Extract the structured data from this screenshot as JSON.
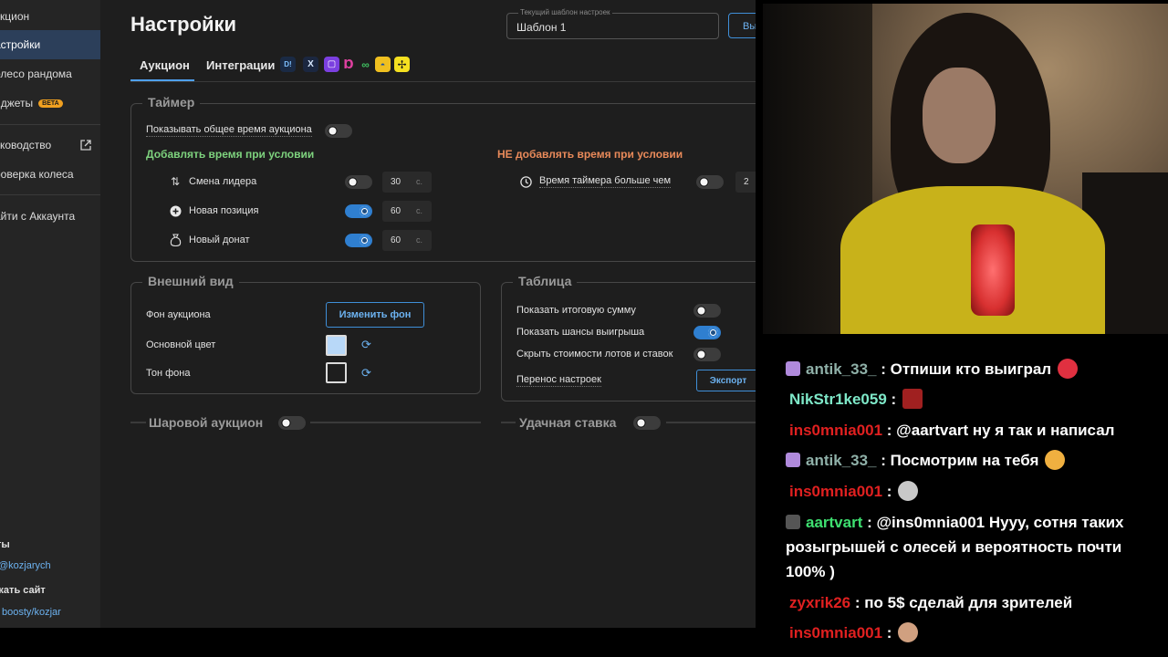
{
  "sidebar": {
    "items": [
      {
        "label": "укцион"
      },
      {
        "label": "астройки"
      },
      {
        "label": "олесо рандома"
      },
      {
        "label": "иджеты",
        "badge": "BETA"
      },
      {
        "label": "уководство"
      },
      {
        "label": "роверка колеса"
      },
      {
        "label": "айти с Аккаунта"
      }
    ],
    "footer": {
      "title1": "ты",
      "handle": "@kozjarych",
      "title2": "жать сайт",
      "boosty": "boosty/kozjar"
    }
  },
  "header": {
    "title": "Настройки",
    "template_label": "Текущий шаблон настроек",
    "template_value": "Шаблон 1",
    "template_button": "Вы"
  },
  "tabs": {
    "auction": "Аукцион",
    "integrations": "Интеграции",
    "integration_icons": [
      "donationalerts-icon",
      "x-icon",
      "twitch-icon",
      "donatepay-icon",
      "link-icon",
      "da-icon",
      "tipeeestream-icon"
    ]
  },
  "timer": {
    "title": "Таймер",
    "show_total": "Показывать общее время аукциона",
    "show_total_on": false,
    "add_title": "Добавлять время при условии",
    "rows": [
      {
        "label": "Смена лидера",
        "on": false,
        "value": "30",
        "unit": "с."
      },
      {
        "label": "Новая позиция",
        "on": true,
        "value": "60",
        "unit": "с."
      },
      {
        "label": "Новый донат",
        "on": true,
        "value": "60",
        "unit": "с."
      }
    ],
    "no_add_title": "НЕ добавлять время при условии",
    "no_add_row": {
      "label": "Время таймера больше чем",
      "on": false,
      "value": "2"
    }
  },
  "appearance": {
    "title": "Внешний вид",
    "bg_label": "Фон аукциона",
    "bg_button": "Изменить фон",
    "main_color_label": "Основной цвет",
    "main_color": "#b8d8f8",
    "bg_tone_label": "Тон фона",
    "bg_tone": "#1e1e1e"
  },
  "table": {
    "title": "Таблица",
    "rows": [
      {
        "label": "Показать итоговую сумму",
        "on": false
      },
      {
        "label": "Показать шансы выигрыша",
        "on": true
      },
      {
        "label": "Скрыть стоимости лотов и ставок",
        "on": false
      }
    ],
    "transfer_label": "Перенос настроек",
    "export_button": "Экспорт"
  },
  "ball_auction": {
    "title": "Шаровой аукцион",
    "on": false
  },
  "lucky_bid": {
    "title": "Удачная ставка",
    "on": false
  },
  "chat": {
    "messages": [
      {
        "user": "antik_33_",
        "color": "#8fb0a8",
        "text": ": Отпиши кто выиграл",
        "badge": true
      },
      {
        "user": "NikStr1ke059",
        "color": "#7ee8c8",
        "text": " :",
        "badge": false
      },
      {
        "user": "ins0mnia001",
        "color": "#e02020",
        "text": " : @aartvart ну я так и написал",
        "badge": false
      },
      {
        "user": "antik_33_",
        "color": "#8fb0a8",
        "text": ": Посмотрим на тебя",
        "badge": true
      },
      {
        "user": "ins0mnia001",
        "color": "#e02020",
        "text": " :",
        "badge": false
      },
      {
        "user": "aartvart",
        "color": "#3ee070",
        "text": " : @ins0mnia001 Нууу, сотня таких",
        "badge": true
      },
      {
        "user": "",
        "color": "#ffffff",
        "text": "розыгрышей с олесей и вероятность почти",
        "badge": false
      },
      {
        "user": "",
        "color": "#ffffff",
        "text": "100% )",
        "badge": false
      },
      {
        "user": "zyxrik26",
        "color": "#e02020",
        "text": " : по 5$ сделай для зрителей",
        "badge": false
      },
      {
        "user": "ins0mnia001",
        "color": "#e02020",
        "text": " :",
        "badge": false
      }
    ]
  }
}
